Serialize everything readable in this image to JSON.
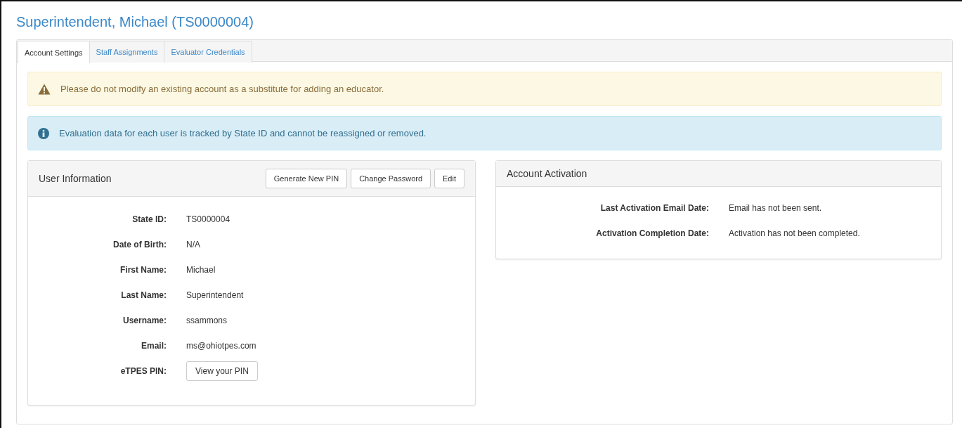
{
  "title": "Superintendent, Michael (TS0000004)",
  "tabs": [
    {
      "label": "Account Settings",
      "selected": true
    },
    {
      "label": "Staff Assignments",
      "selected": false
    },
    {
      "label": "Evaluator Credentials",
      "selected": false
    }
  ],
  "alerts": [
    {
      "kind": "warning",
      "text": "Please do not modify an existing account as a substitute for adding an educator."
    },
    {
      "kind": "info",
      "text": "Evaluation data for each user is tracked by State ID and cannot be reassigned or removed."
    }
  ],
  "user_information": {
    "heading": "User Information",
    "buttons": [
      "Generate New PIN",
      "Change Password",
      "Edit"
    ],
    "fields": [
      {
        "label": "State ID:",
        "value": "TS0000004",
        "kind": "text"
      },
      {
        "label": "Date of Birth:",
        "value": "N/A",
        "kind": "text"
      },
      {
        "label": "First Name:",
        "value": "Michael",
        "kind": "text"
      },
      {
        "label": "Last Name:",
        "value": "Superintendent",
        "kind": "text"
      },
      {
        "label": "Username:",
        "value": "ssammons",
        "kind": "text"
      },
      {
        "label": "Email:",
        "value": "ms@ohiotpes.com",
        "kind": "text"
      },
      {
        "label": "eTPES PIN:",
        "value": "View your PIN",
        "kind": "button"
      }
    ]
  },
  "account_activation": {
    "heading": "Account Activation",
    "fields": [
      {
        "label": "Last Activation Email Date:",
        "value": "Email has not been sent."
      },
      {
        "label": "Activation Completion Date:",
        "value": "Activation has not been completed."
      }
    ]
  }
}
